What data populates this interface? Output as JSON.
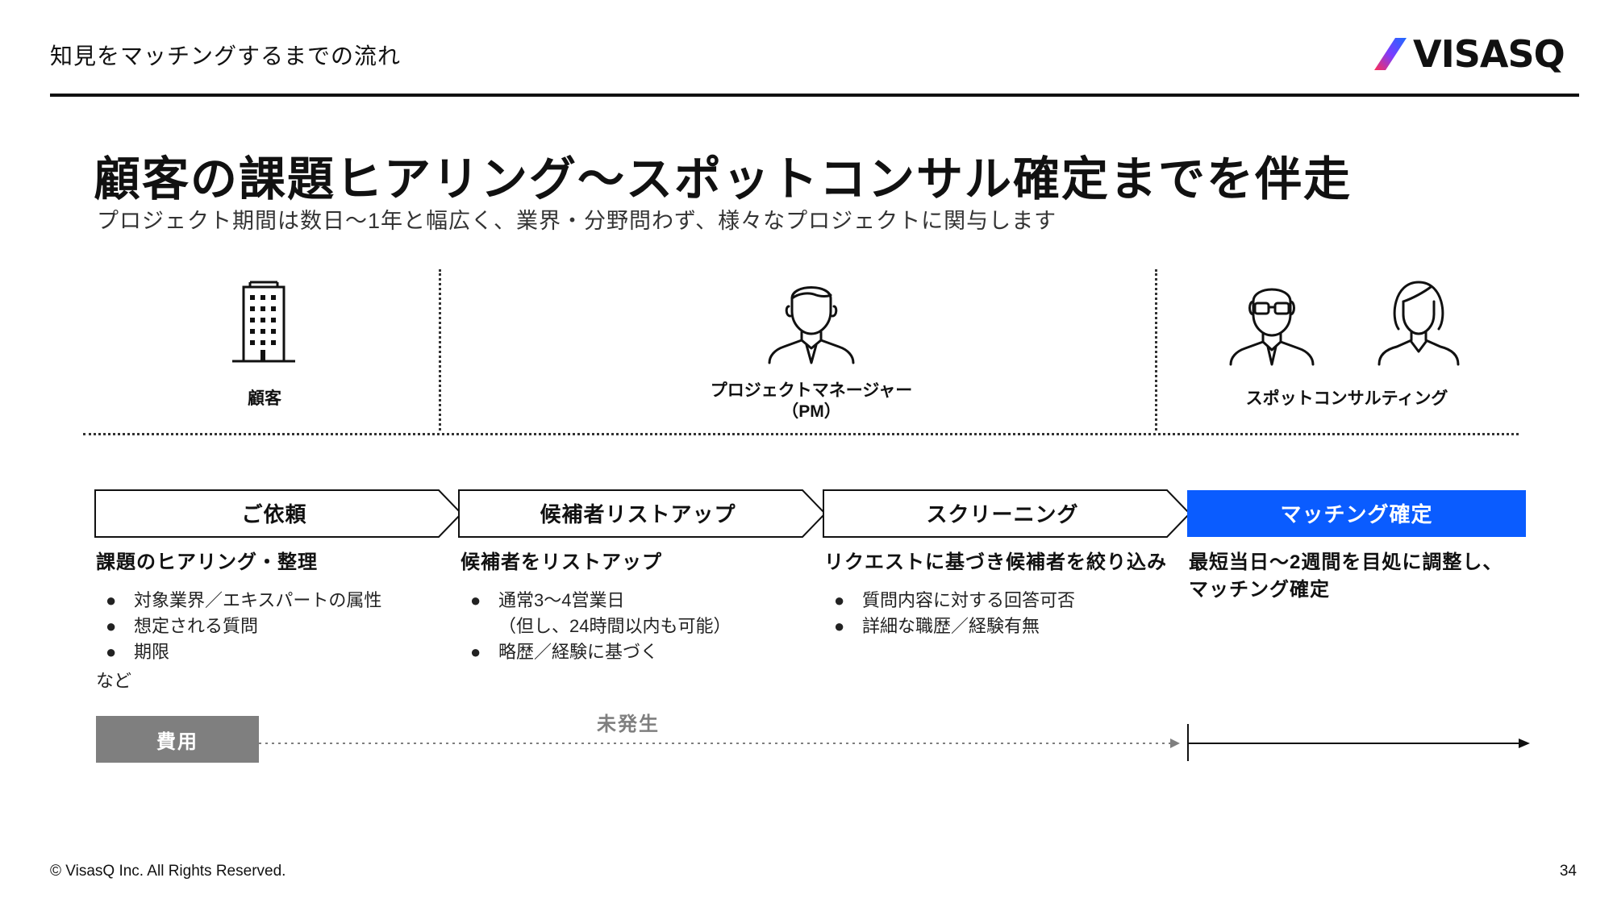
{
  "header": {
    "title": "知見をマッチングするまでの流れ",
    "logo_text": "VISASQ"
  },
  "main": {
    "title": "顧客の課題ヒアリング〜スポットコンサル確定までを伴走",
    "subtitle": "プロジェクト期間は数日〜1年と幅広く、業界・分野問わず、様々なプロジェクトに関与します"
  },
  "roles": {
    "customer": "顧客",
    "pm_line1": "プロジェクトマネージャー",
    "pm_line2": "（PM）",
    "consulting": "スポットコンサルティング"
  },
  "steps": [
    {
      "label": "ご依頼",
      "heading": "課題のヒアリング・整理",
      "bullets": [
        "対象業界／エキスパートの属性",
        "想定される質問",
        "期限"
      ],
      "note": "など"
    },
    {
      "label": "候補者リストアップ",
      "heading": "候補者をリストアップ",
      "bullets": [
        "通常3〜4営業日",
        "略歴／経験に基づく"
      ],
      "note": "（但し、24時間以内も可能）"
    },
    {
      "label": "スクリーニング",
      "heading": "リクエストに基づき候補者を絞り込み",
      "bullets": [
        "質問内容に対する回答可否",
        "詳細な職歴／経験有無"
      ]
    },
    {
      "label": "マッチング確定",
      "heading_line1": "最短当日〜2週間を目処に調整し、",
      "heading_line2": "マッチング確定"
    }
  ],
  "bullet_glyph": "●",
  "cost": {
    "label": "費用",
    "not_incurred": "未発生"
  },
  "footer": {
    "copyright": "© VisasQ Inc. All Rights Reserved.",
    "page_number": "34"
  },
  "colors": {
    "accent_blue": "#0a5cff",
    "cost_gray": "#7f7f7f",
    "logo_gradient": [
      "#ff2d55",
      "#7b3cff",
      "#1d6bff"
    ]
  }
}
